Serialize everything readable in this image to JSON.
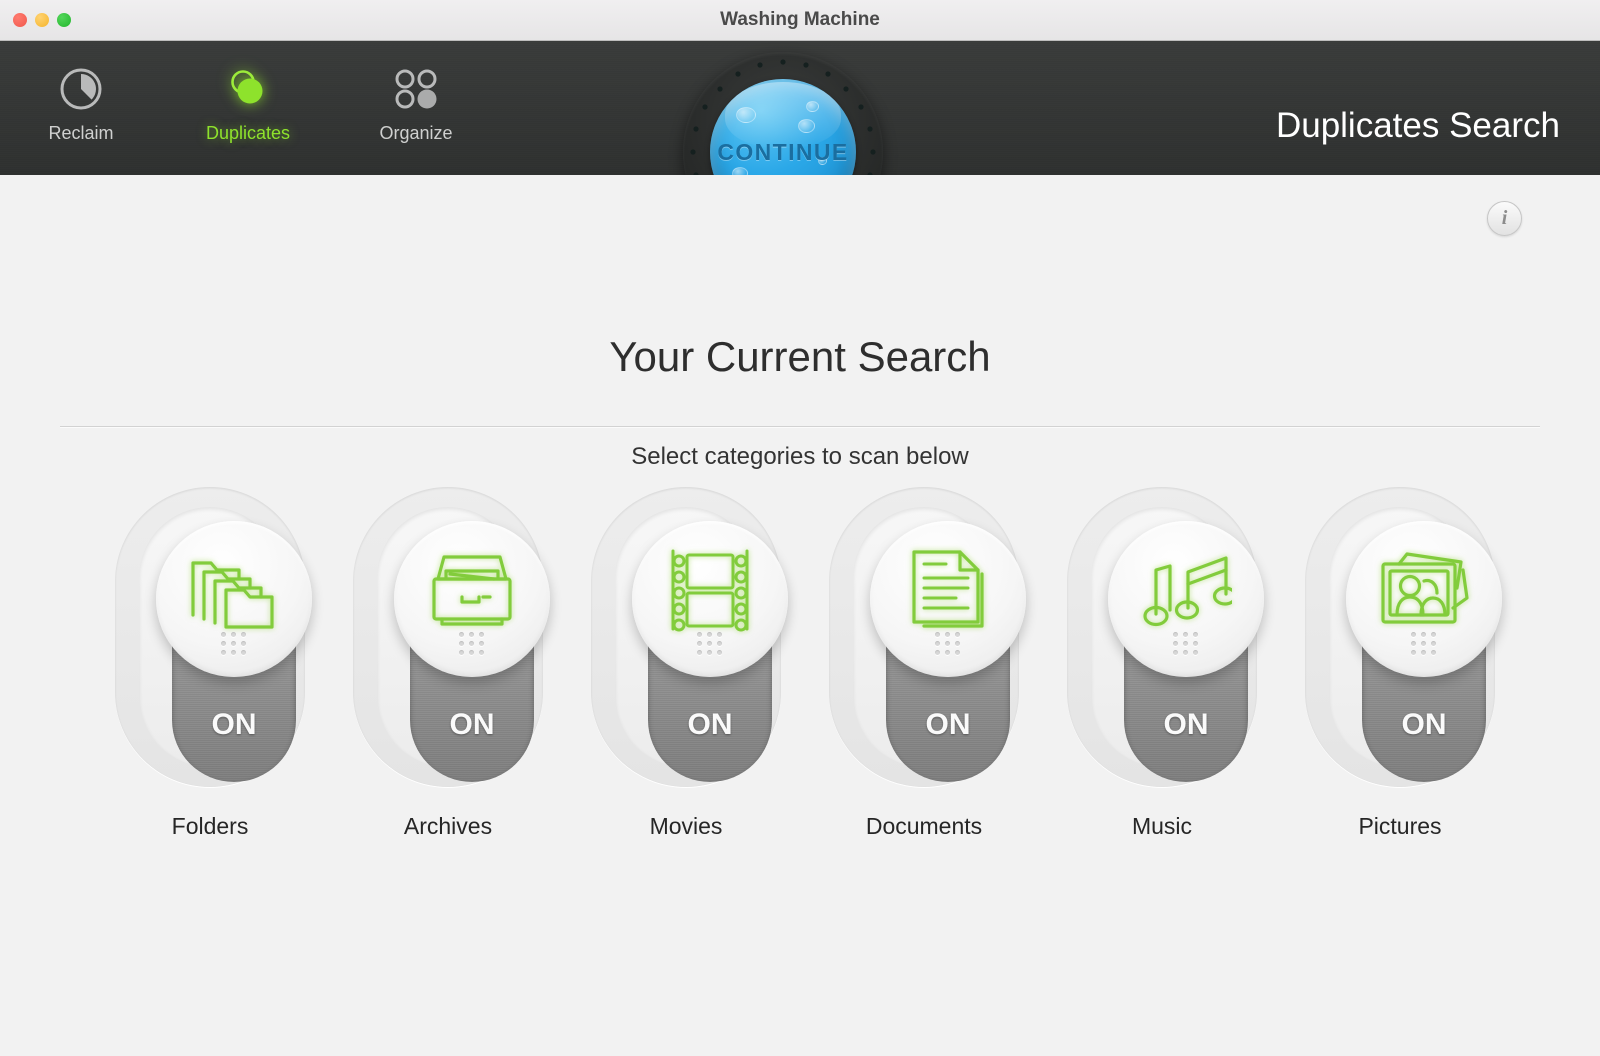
{
  "window": {
    "title": "Washing Machine",
    "traffic_lights": [
      "close",
      "minimize",
      "maximize"
    ]
  },
  "toolbar": {
    "items": [
      {
        "label": "Reclaim",
        "icon": "clock-icon",
        "active": false
      },
      {
        "label": "Duplicates",
        "icon": "overlapping-circles-icon",
        "active": true
      },
      {
        "label": "Organize",
        "icon": "four-circles-grid-icon",
        "active": false
      }
    ],
    "continue_button": {
      "label": "CONTINUE",
      "icon": "water-bubbles"
    },
    "header_title": "Duplicates Search"
  },
  "main": {
    "info_button": "i",
    "page_title": "Your Current Search",
    "subtitle": "Select categories to scan below",
    "categories": [
      {
        "label": "Folders",
        "state": "ON",
        "icon": "folders-icon"
      },
      {
        "label": "Archives",
        "state": "ON",
        "icon": "archive-box-icon"
      },
      {
        "label": "Movies",
        "state": "ON",
        "icon": "film-strip-icon"
      },
      {
        "label": "Documents",
        "state": "ON",
        "icon": "document-page-icon"
      },
      {
        "label": "Music",
        "state": "ON",
        "icon": "music-notes-icon"
      },
      {
        "label": "Pictures",
        "state": "ON",
        "icon": "photos-people-icon"
      }
    ]
  },
  "colors": {
    "accent_green": "#8ee22c",
    "icon_green": "#7ac43a",
    "continue_blue": "#2ba8e8",
    "toolbar_dark": "#31332f",
    "background": "#f2f2f2"
  }
}
